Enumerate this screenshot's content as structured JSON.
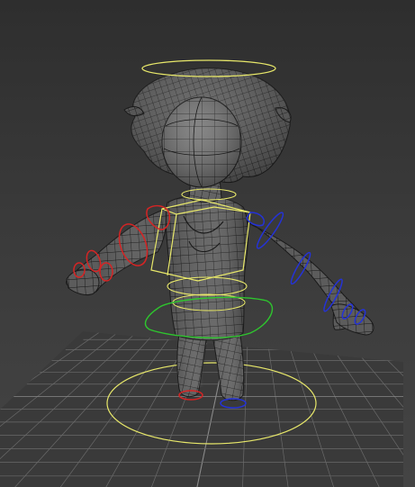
{
  "viewport": {
    "panel": "perspective-viewport",
    "content": "character-rig"
  },
  "colors": {
    "background_top": "#2e2e2e",
    "background_bottom": "#444444",
    "grid": "#6a6a6a",
    "grid_axis": "#8a8a8a",
    "mesh_fill": "#5d5d5d",
    "wire": "#161616",
    "control_main": "#e8e86a",
    "control_cog": "#2ec52e",
    "control_left": "#d62424",
    "control_right": "#2432d8"
  },
  "rig_controls": [
    {
      "id": "head-control",
      "color": "control_main"
    },
    {
      "id": "chest-control",
      "color": "control_main"
    },
    {
      "id": "hips-control",
      "color": "control_main"
    },
    {
      "id": "cog-control",
      "color": "control_cog"
    },
    {
      "id": "world-control",
      "color": "control_main"
    },
    {
      "id": "left-arm-controls",
      "color": "control_left"
    },
    {
      "id": "right-arm-controls",
      "color": "control_right"
    },
    {
      "id": "left-foot-control",
      "color": "control_left"
    },
    {
      "id": "right-foot-control",
      "color": "control_right"
    }
  ]
}
